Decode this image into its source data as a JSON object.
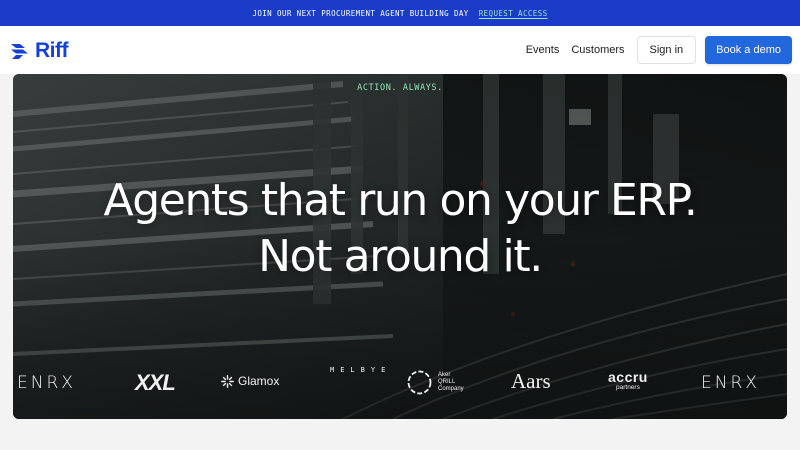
{
  "announcement": {
    "text": "JOIN OUR NEXT PROCUREMENT AGENT BUILDING DAY",
    "link_label": "REQUEST ACCESS"
  },
  "nav": {
    "logo_text": "Riff",
    "links": [
      {
        "label": "Events"
      },
      {
        "label": "Customers"
      }
    ],
    "signin_label": "Sign in",
    "demo_label": "Book a demo"
  },
  "hero": {
    "eyebrow": "ACTION. ALWAYS.",
    "headline_line1": "Agents that run on your ERP.",
    "headline_line2": "Not around it."
  },
  "customer_logos": {
    "enrx": "ENRX",
    "xxl": "XXL",
    "glamox": "Glamox",
    "melbye": "MELBYE",
    "aker_lines": [
      "Aker",
      "QRILL",
      "Company"
    ],
    "aars": "Aars",
    "accru": "accru",
    "accru_sub": "partners"
  },
  "colors": {
    "announce_bg": "#1a3cc8",
    "brand_blue": "#1541d9",
    "cta_blue": "#2267de",
    "eyebrow_green": "#8ee6b8"
  }
}
